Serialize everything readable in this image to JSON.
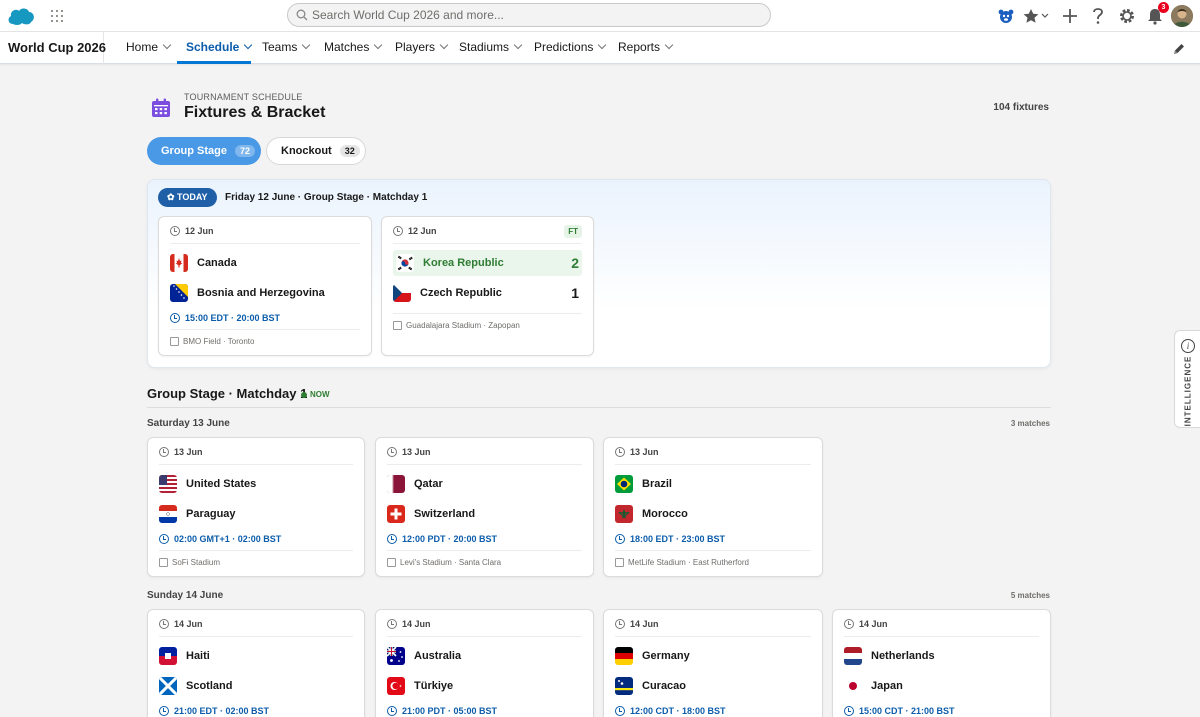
{
  "global_header": {
    "search_placeholder": "Search World Cup 2026 and more...",
    "notification_count": "3",
    "icons": [
      "salesforce-cloud-icon",
      "app-launcher-icon",
      "search-icon",
      "mascot-icon",
      "favorites-star-icon",
      "add-icon",
      "help-icon",
      "setup-gear-icon",
      "notification-bell-icon",
      "user-avatar"
    ]
  },
  "nav": {
    "app_name": "World Cup 2026",
    "items": [
      "Home",
      "Schedule",
      "Teams",
      "Matches",
      "Players",
      "Stadiums",
      "Predictions",
      "Reports"
    ],
    "active": "Schedule"
  },
  "page_header": {
    "kicker": "TOURNAMENT SCHEDULE",
    "title": "Fixtures & Bracket",
    "fixture_count": "104 fixtures"
  },
  "tabs": [
    {
      "label": "Group Stage",
      "count": "72",
      "active": true
    },
    {
      "label": "Knockout",
      "count": "32",
      "active": false
    }
  ],
  "today": {
    "badge": "✿ TODAY",
    "text": "Friday 12 June · Group Stage · Matchday 1",
    "matches": [
      {
        "date": "12 Jun",
        "home": "Canada",
        "away": "Bosnia and Herzegovina",
        "kickoff": "15:00 EDT · 20:00 BST",
        "venue": "BMO Field · Toronto"
      },
      {
        "date": "12 Jun",
        "status": "FT",
        "home": "Korea Republic",
        "home_score": "2",
        "away": "Czech Republic",
        "away_score": "1",
        "venue": "Guadalajara Stadium · Zapopan"
      }
    ]
  },
  "section": {
    "title": "Group Stage · Matchday 1",
    "status": "NOW",
    "days": [
      {
        "label": "Saturday 13 June",
        "count": "3 matches",
        "matches": [
          {
            "date": "13 Jun",
            "home": "United States",
            "away": "Paraguay",
            "kickoff": "02:00 GMT+1 · 02:00 BST",
            "venue": "SoFi Stadium"
          },
          {
            "date": "13 Jun",
            "home": "Qatar",
            "away": "Switzerland",
            "kickoff": "12:00 PDT · 20:00 BST",
            "venue": "Levi's Stadium · Santa Clara"
          },
          {
            "date": "13 Jun",
            "home": "Brazil",
            "away": "Morocco",
            "kickoff": "18:00 EDT · 23:00 BST",
            "venue": "MetLife Stadium · East Rutherford"
          }
        ]
      },
      {
        "label": "Sunday 14 June",
        "count": "5 matches",
        "matches": [
          {
            "date": "14 Jun",
            "home": "Haiti",
            "away": "Scotland",
            "kickoff": "21:00 EDT · 02:00 BST"
          },
          {
            "date": "14 Jun",
            "home": "Australia",
            "away": "Türkiye",
            "kickoff": "21:00 PDT · 05:00 BST"
          },
          {
            "date": "14 Jun",
            "home": "Germany",
            "away": "Curacao",
            "kickoff": "12:00 CDT · 18:00 BST"
          },
          {
            "date": "14 Jun",
            "home": "Netherlands",
            "away": "Japan",
            "kickoff": "15:00 CDT · 21:00 BST"
          }
        ]
      }
    ]
  },
  "side_panel": {
    "label": "INTELLIGENCE"
  }
}
